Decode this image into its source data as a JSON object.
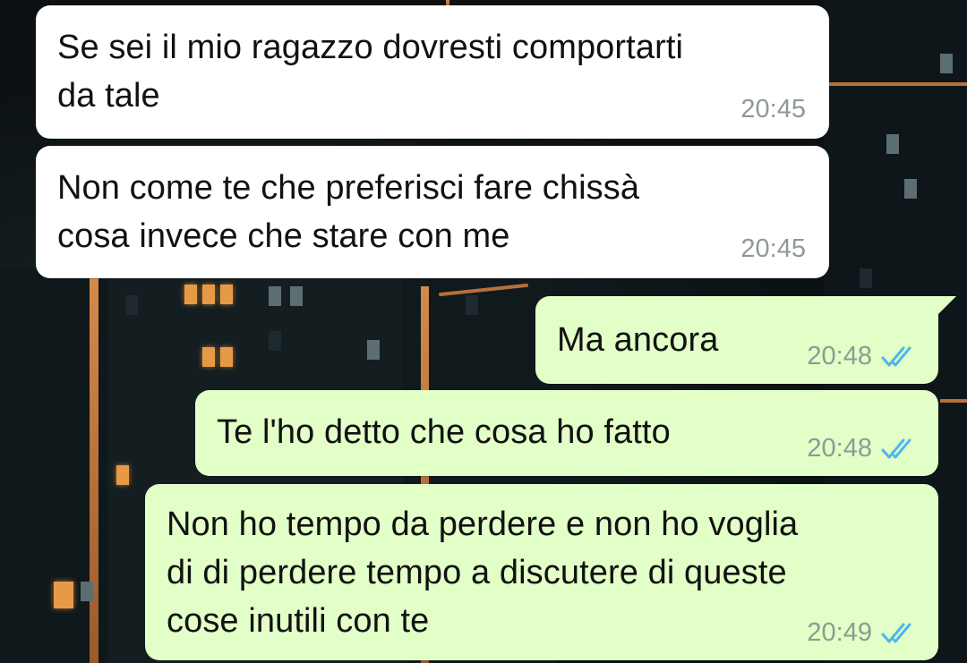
{
  "chat": {
    "messages": [
      {
        "direction": "in",
        "text": "Se sei il mio ragazzo dovresti comportarti\nda tale",
        "time": "20:45"
      },
      {
        "direction": "in",
        "text": "Non come te che preferisci fare chissà\ncosa invece che stare con me",
        "time": "20:45"
      },
      {
        "direction": "out",
        "text": "Ma ancora",
        "time": "20:48",
        "status_icon": "double-check-icon"
      },
      {
        "direction": "out",
        "text": "Te l'ho detto che cosa ho fatto",
        "time": "20:48",
        "status_icon": "double-check-icon"
      },
      {
        "direction": "out",
        "text": "Non ho tempo da perdere e non ho voglia\ndi di perdere tempo a discutere di queste\ncose inutili con te",
        "time": "20:49",
        "status_icon": "double-check-icon"
      }
    ]
  },
  "colors": {
    "incoming_bubble": "#ffffff",
    "outgoing_bubble": "#e2ffc7",
    "timestamp": "#8e9a93",
    "read_check": "#4fb6ec"
  }
}
